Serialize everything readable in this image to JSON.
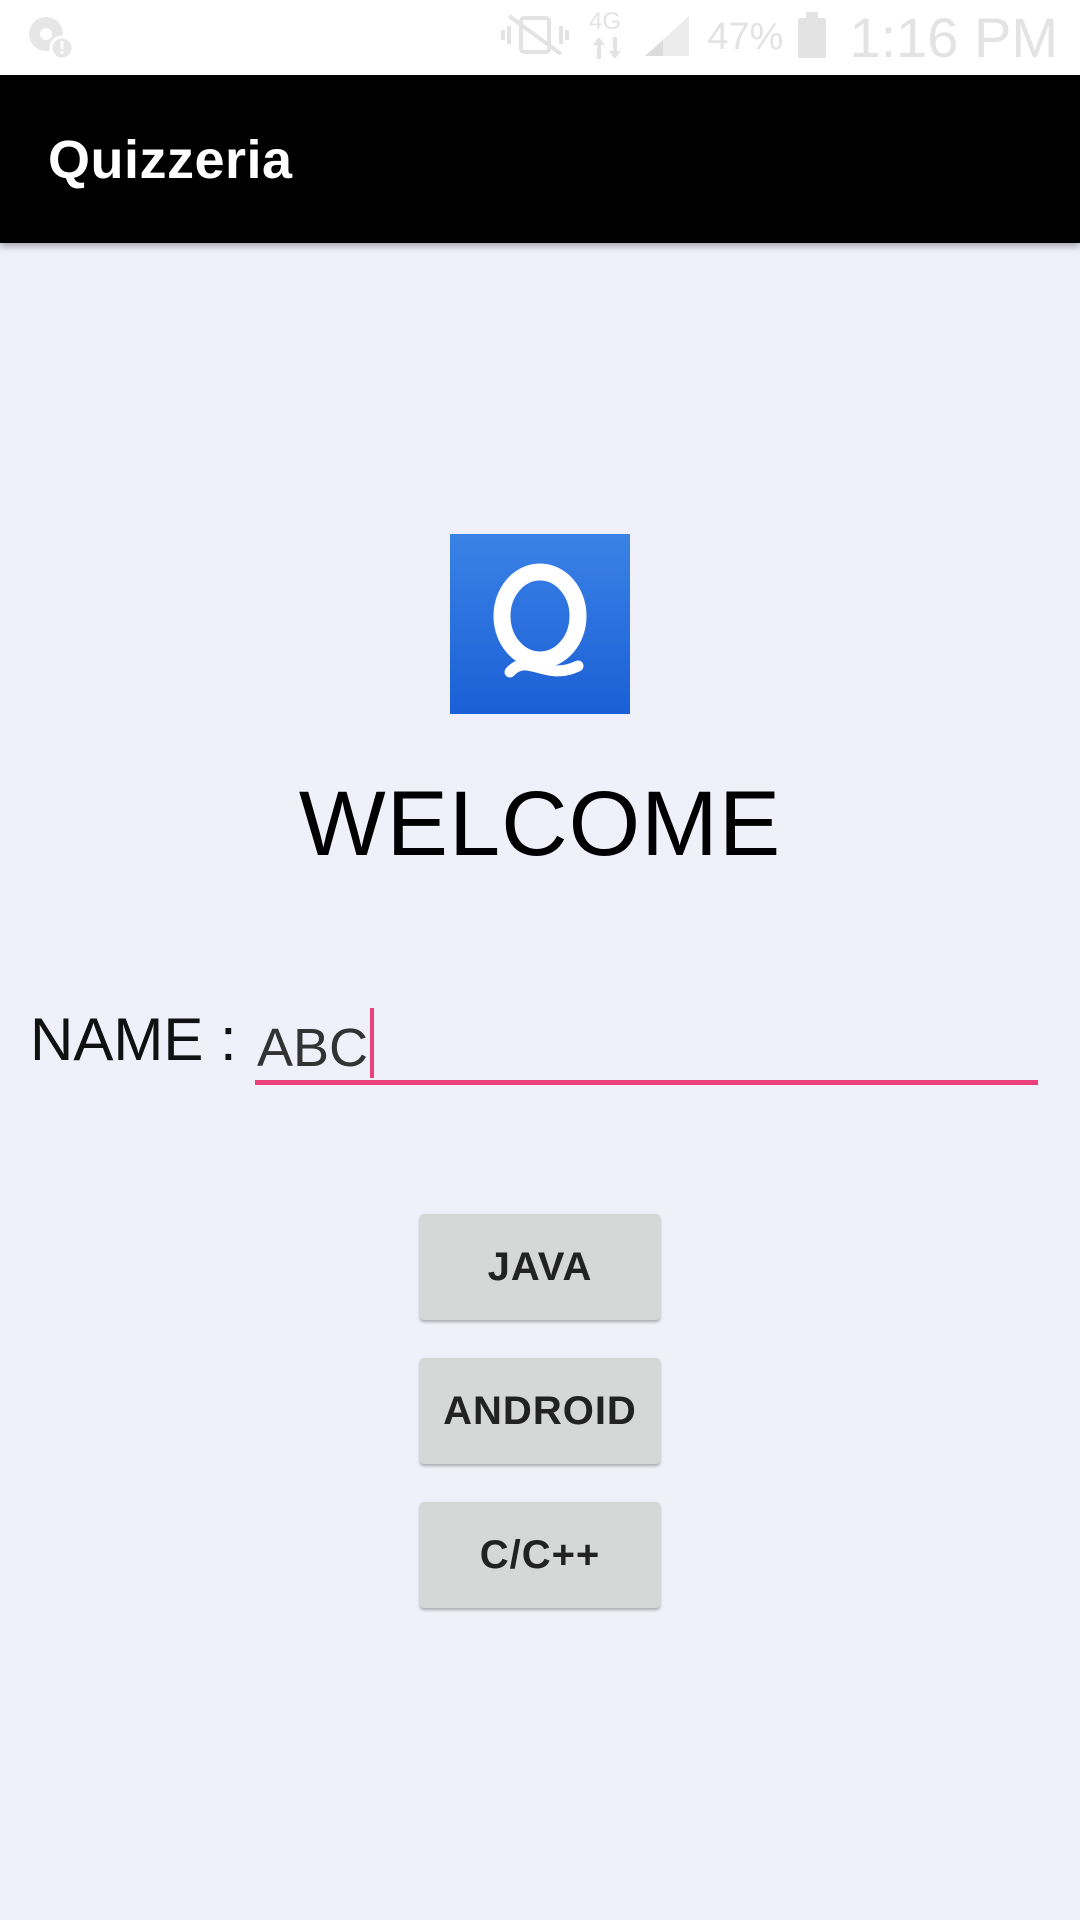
{
  "status_bar": {
    "left_icon": "notification-alert-icon",
    "icons": [
      "vibrate-mute-icon",
      "4g-data-icon",
      "signal-icon",
      "battery-icon"
    ],
    "network_type": "4G",
    "battery_percent": "47%",
    "time": "1:16 PM"
  },
  "toolbar": {
    "title": "Quizzeria"
  },
  "logo": {
    "letter": "Q",
    "background_color": "#2a6fe0"
  },
  "main": {
    "welcome_text": "WELCOME",
    "name_label": "NAME :",
    "name_value": "ABC",
    "accent_color": "#ec407a",
    "buttons": {
      "java": "JAVA",
      "android": "ANDROID",
      "c": "C/C++"
    }
  }
}
